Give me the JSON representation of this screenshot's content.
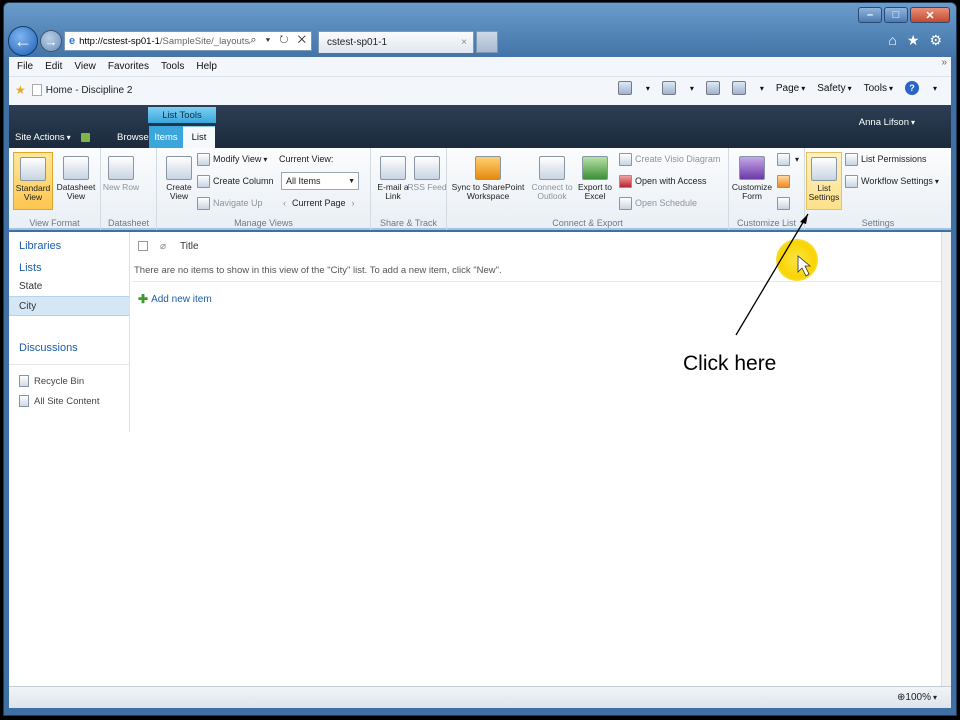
{
  "window": {
    "min": "–",
    "max": "□",
    "close": "✕"
  },
  "browser": {
    "address_host": "http://cstest-sp01-1",
    "address_path": "/SampleSite/_layouts/l",
    "address_tools": "⌕ ▾ ↻ ✕",
    "tab_title": "cstest-sp01-1",
    "tab_close": "×",
    "nav_right": [
      "⌂",
      "★",
      "⚙"
    ],
    "menu": [
      "File",
      "Edit",
      "View",
      "Favorites",
      "Tools",
      "Help"
    ],
    "favorites_item": "Home - Discipline 2",
    "more": "»",
    "commands": [
      "Page",
      "Safety",
      "Tools"
    ],
    "help": "?"
  },
  "sharepoint": {
    "context_tab": "List Tools",
    "tabs": {
      "site_actions": "Site Actions",
      "browse": "Browse",
      "items": "Items",
      "list": "List"
    },
    "user": "Anna Lifson",
    "ribbon": {
      "view_format": {
        "label": "View Format",
        "standard": "Standard View",
        "datasheet": "Datasheet View"
      },
      "datasheet": {
        "label": "Datasheet",
        "new_row": "New Row"
      },
      "manage_views": {
        "label": "Manage Views",
        "create_view": "Create View",
        "modify_view": "Modify View",
        "create_column": "Create Column",
        "navigate_up": "Navigate Up",
        "current_view_label": "Current View:",
        "current_view_value": "All Items",
        "current_page": "Current Page"
      },
      "share_track": {
        "label": "Share & Track",
        "email": "E-mail a Link",
        "rss": "RSS Feed"
      },
      "connect_export": {
        "label": "Connect & Export",
        "sync": "Sync to SharePoint Workspace",
        "outlook": "Connect to Outlook",
        "excel": "Export to Excel",
        "visio": "Create Visio Diagram",
        "access": "Open with Access",
        "schedule": "Open Schedule"
      },
      "customize_list": {
        "label": "Customize List",
        "form": "Customize Form"
      },
      "settings": {
        "label": "Settings",
        "list_settings": "List Settings",
        "permissions": "List Permissions",
        "workflow": "Workflow Settings"
      }
    },
    "quick_launch": {
      "libraries": "Libraries",
      "lists": "Lists",
      "items": [
        "State",
        "City"
      ],
      "discussions": "Discussions",
      "recycle_bin": "Recycle Bin",
      "all_content": "All Site Content"
    },
    "list": {
      "column_title": "Title",
      "empty_message": "There are no items to show in this view of the \"City\" list. To add a new item, click \"New\".",
      "add_new": "Add new item"
    }
  },
  "status": {
    "zoom": "100%"
  },
  "annotation": {
    "text": "Click here"
  }
}
